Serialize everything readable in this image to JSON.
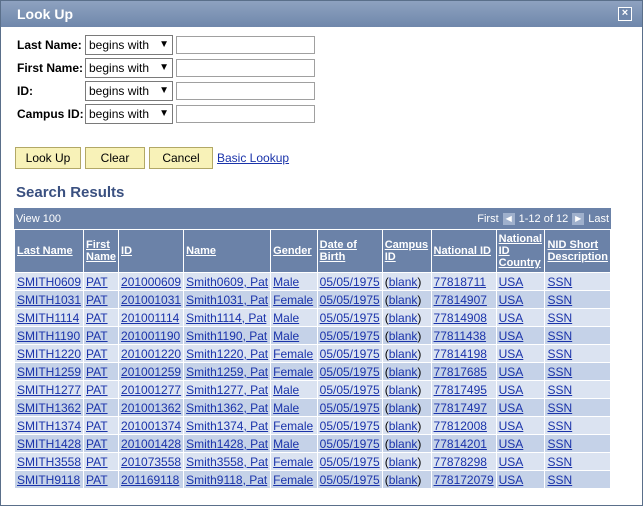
{
  "window": {
    "title": "Look Up",
    "close_label": "×"
  },
  "form": {
    "fields": [
      {
        "label": "Last Name:",
        "op": "begins with"
      },
      {
        "label": "First Name:",
        "op": "begins with"
      },
      {
        "label": "ID:",
        "op": "begins with"
      },
      {
        "label": "Campus ID:",
        "op": "begins with"
      }
    ]
  },
  "buttons": {
    "lookup": "Look Up",
    "clear": "Clear",
    "cancel": "Cancel",
    "basic": "Basic Lookup"
  },
  "results": {
    "title": "Search Results",
    "view_all": "View 100",
    "first": "First",
    "range": "1-12 of 12",
    "last": "Last",
    "columns": [
      "Last Name",
      "First Name",
      "ID",
      "Name",
      "Gender",
      "Date of Birth",
      "Campus ID",
      "National ID",
      "National ID Country",
      "NID Short Description"
    ],
    "rows": [
      [
        "SMITH0609",
        "PAT",
        "201000609",
        "Smith0609, Pat",
        "Male",
        "05/05/1975",
        "blank",
        "77818711",
        "USA",
        "SSN"
      ],
      [
        "SMITH1031",
        "PAT",
        "201001031",
        "Smith1031, Pat",
        "Female",
        "05/05/1975",
        "blank",
        "77814907",
        "USA",
        "SSN"
      ],
      [
        "SMITH1114",
        "PAT",
        "201001114",
        "Smith1114, Pat",
        "Male",
        "05/05/1975",
        "blank",
        "77814908",
        "USA",
        "SSN"
      ],
      [
        "SMITH1190",
        "PAT",
        "201001190",
        "Smith1190, Pat",
        "Male",
        "05/05/1975",
        "blank",
        "77811438",
        "USA",
        "SSN"
      ],
      [
        "SMITH1220",
        "PAT",
        "201001220",
        "Smith1220, Pat",
        "Female",
        "05/05/1975",
        "blank",
        "77814198",
        "USA",
        "SSN"
      ],
      [
        "SMITH1259",
        "PAT",
        "201001259",
        "Smith1259, Pat",
        "Female",
        "05/05/1975",
        "blank",
        "77817685",
        "USA",
        "SSN"
      ],
      [
        "SMITH1277",
        "PAT",
        "201001277",
        "Smith1277, Pat",
        "Male",
        "05/05/1975",
        "blank",
        "77817495",
        "USA",
        "SSN"
      ],
      [
        "SMITH1362",
        "PAT",
        "201001362",
        "Smith1362, Pat",
        "Male",
        "05/05/1975",
        "blank",
        "77817497",
        "USA",
        "SSN"
      ],
      [
        "SMITH1374",
        "PAT",
        "201001374",
        "Smith1374, Pat",
        "Female",
        "05/05/1975",
        "blank",
        "77812008",
        "USA",
        "SSN"
      ],
      [
        "SMITH1428",
        "PAT",
        "201001428",
        "Smith1428, Pat",
        "Male",
        "05/05/1975",
        "blank",
        "77814201",
        "USA",
        "SSN"
      ],
      [
        "SMITH3558",
        "PAT",
        "201073558",
        "Smith3558, Pat",
        "Female",
        "05/05/1975",
        "blank",
        "77878298",
        "USA",
        "SSN"
      ],
      [
        "SMITH9118",
        "PAT",
        "201169118",
        "Smith9118, Pat",
        "Female",
        "05/05/1975",
        "blank",
        "778172079",
        "USA",
        "SSN"
      ]
    ]
  }
}
